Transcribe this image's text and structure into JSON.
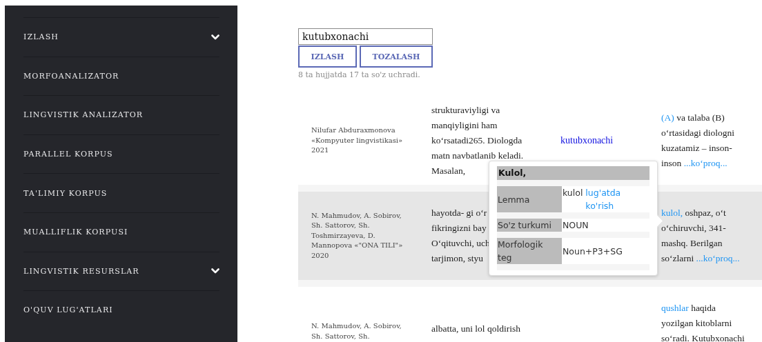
{
  "sidebar": {
    "items": [
      {
        "label": "IZLASH",
        "submenu": true
      },
      {
        "label": "MORFOANALIZATOR",
        "submenu": false
      },
      {
        "label": "LINGVISTIK ANALIZATOR",
        "submenu": false
      },
      {
        "label": "PARALLEL KORPUS",
        "submenu": false
      },
      {
        "label": "TA'LIMIY KORPUS",
        "submenu": false
      },
      {
        "label": "MUALLIFLIK KORPUSI",
        "submenu": false
      },
      {
        "label": "LINGVISTIK RESURSLAR",
        "submenu": true
      },
      {
        "label": "O'QUV LUG'ATLARI",
        "submenu": false
      }
    ]
  },
  "search": {
    "value": "kutubxonachi",
    "buttons": [
      "IZLASH",
      "TOZALASH"
    ],
    "summary": "8 ta hujjatda 17 ta so'z uchradi."
  },
  "results": [
    {
      "highlighted": false,
      "source": [
        "Nilufar Abduraxmonova",
        "«Kompyuter lingvistikasi»",
        "2021"
      ],
      "left": [
        "strukturaviyligi va",
        "manqiyligini ham",
        "ko‘rsatadi265. Diologda",
        "matn navbatlanib keladi.",
        "Masalan,"
      ],
      "keyword": "kutubxonachi",
      "right": {
        "highlight": "(A)",
        "lines": [
          "va talaba (B)",
          "o‘rtasidagi diologni",
          "kuzatamiz – inson-",
          "inson"
        ],
        "more": "...ko‘proq..."
      }
    },
    {
      "highlighted": true,
      "source": [
        "N. Mahmudov, A. Sobirov,",
        "Sh. Sattorov, Sh.",
        "Toshmirzayeva, D.",
        "Mannopova «\"ONA TILI\"»",
        "2020"
      ],
      "left": [
        "hayotda- gi o‘r",
        "fikringizni bay",
        "O‘qituvchi, uch",
        "tarjimon, styu"
      ],
      "right": {
        "highlight": "kulol,",
        "lines": [
          "oshpaz, o‘t",
          "o‘chiruvchi, 341-",
          "mashq. Berilgan",
          "so‘zlarni"
        ],
        "more": "...ko‘proq..."
      }
    },
    {
      "highlighted": false,
      "source": [
        "N. Mahmudov, A. Sobirov,",
        "Sh. Sattorov, Sh."
      ],
      "left": [
        "albatta, uni lol qoldirish"
      ],
      "right": {
        "highlight": "qushlar",
        "lines": [
          "haqida",
          "yozilgan kitoblarni",
          "so‘radi. Kutubxonachi"
        ]
      }
    }
  ],
  "popup": {
    "title": "Kulol,",
    "rows": [
      {
        "label": "Lemma",
        "value": "kulol",
        "link": "lug'atda ko'rish"
      },
      {
        "label": "So'z turkumi",
        "value": "NOUN"
      },
      {
        "label": "Morfologik teg",
        "value": "Noun+P3+SG"
      }
    ]
  }
}
